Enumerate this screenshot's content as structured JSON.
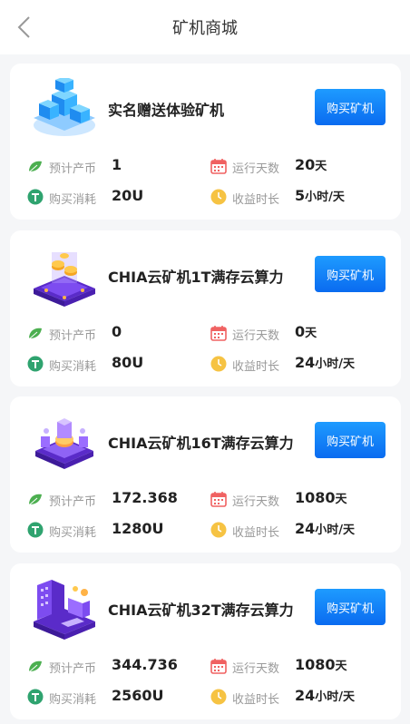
{
  "header": {
    "title": "矿机商城"
  },
  "labels": {
    "produce": "预计产币",
    "run_days": "运行天数",
    "cost": "购买消耗",
    "duration": "收益时长"
  },
  "colors": {
    "button": "#0a6bf0",
    "leaf": "#4caf50",
    "calendar": "#f06262",
    "coin": "#2fa36f",
    "clock": "#f6c343"
  },
  "cards": [
    {
      "name": "实名赠送体验矿机",
      "button": "购买矿机",
      "produce": "1",
      "days": "20",
      "days_unit": "天",
      "cost": "20U",
      "hours": "5",
      "hours_unit": "小时/天",
      "image": "server-stack-icon"
    },
    {
      "name": "CHIA云矿机1T满存云算力",
      "button": "购买矿机",
      "produce": "0",
      "days": "0",
      "days_unit": "天",
      "cost": "80U",
      "hours": "24",
      "hours_unit": "小时/天",
      "image": "coin-platform-icon"
    },
    {
      "name": "CHIA云矿机16T满存云算力",
      "button": "购买矿机",
      "produce": "172.368",
      "days": "1080",
      "days_unit": "天",
      "cost": "1280U",
      "hours": "24",
      "hours_unit": "小时/天",
      "image": "mining-rig-icon"
    },
    {
      "name": "CHIA云矿机32T满存云算力",
      "button": "购买矿机",
      "produce": "344.736",
      "days": "1080",
      "days_unit": "天",
      "cost": "2560U",
      "hours": "24",
      "hours_unit": "小时/天",
      "image": "data-center-icon"
    }
  ]
}
